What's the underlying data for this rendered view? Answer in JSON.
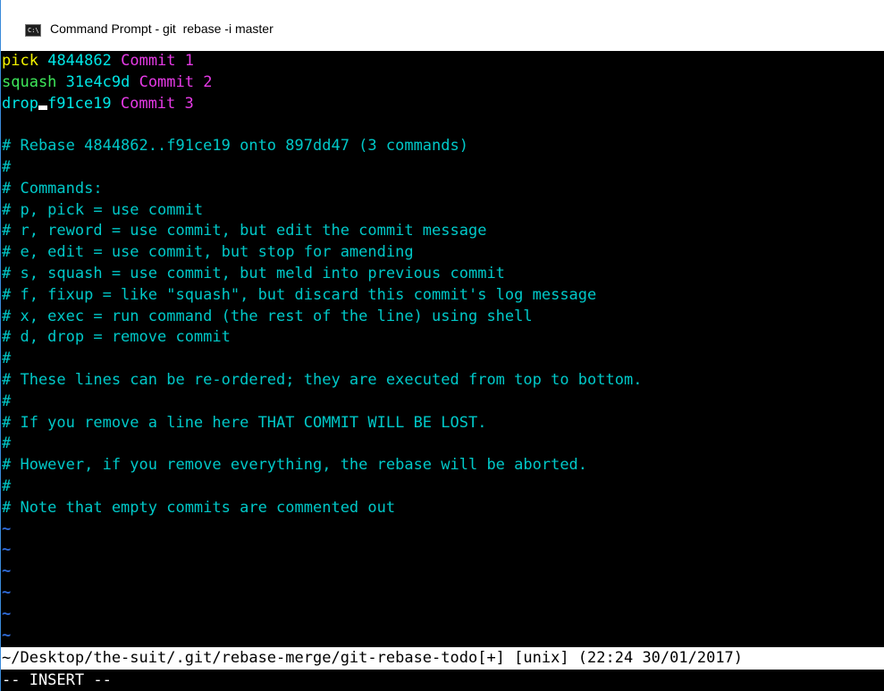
{
  "window": {
    "title": "Command Prompt - git  rebase -i master",
    "icon_label": "C:\\"
  },
  "todo": [
    {
      "command": "pick",
      "hash": "4844862",
      "message": "Commit 1"
    },
    {
      "command": "squash",
      "hash": "31e4c9d",
      "message": "Commit 2"
    },
    {
      "command": "drop",
      "hash": "f91ce19",
      "message": "Commit 3"
    }
  ],
  "comments": [
    "# Rebase 4844862..f91ce19 onto 897dd47 (3 commands)",
    "#",
    "# Commands:",
    "# p, pick = use commit",
    "# r, reword = use commit, but edit the commit message",
    "# e, edit = use commit, but stop for amending",
    "# s, squash = use commit, but meld into previous commit",
    "# f, fixup = like \"squash\", but discard this commit's log message",
    "# x, exec = run command (the rest of the line) using shell",
    "# d, drop = remove commit",
    "#",
    "# These lines can be re-ordered; they are executed from top to bottom.",
    "#",
    "# If you remove a line here THAT COMMIT WILL BE LOST.",
    "#",
    "# However, if you remove everything, the rebase will be aborted.",
    "#",
    "# Note that empty commits are commented out"
  ],
  "filler": [
    "~",
    "~",
    "~",
    "~",
    "~",
    "~"
  ],
  "status_line": "~/Desktop/the-suit/.git/rebase-merge/git-rebase-todo[+] [unix] (22:24 30/01/2017)",
  "mode_line": "-- INSERT --",
  "colors": {
    "background": "#000000",
    "pick": "#f5f500",
    "squash": "#3ee85a",
    "drop": "#00e6e6",
    "message": "#e63ae6",
    "comment": "#00c8c8",
    "tilde": "#2f6bd8"
  }
}
